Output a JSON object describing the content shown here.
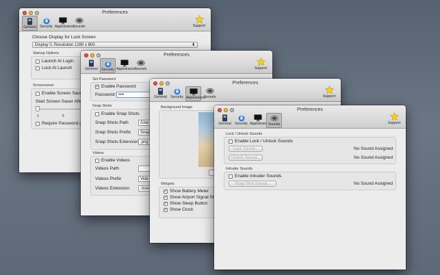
{
  "common": {
    "window_title": "Preferences",
    "tabs": [
      "General",
      "Security",
      "Appearance",
      "Sounds"
    ],
    "support_label": "Support"
  },
  "general": {
    "choose_display_label": "Choose Display for Lock Screen",
    "display_value": "Display 0, Resolution 1280 x 800",
    "startup_section": "Startup Options",
    "launch_at_login": "Launch At Login",
    "lock_at_launch": "Lock At Launch",
    "screensaver_section": "Screensaver",
    "enable_screen_saver": "Enable Screen Saver",
    "start_screen_saver_after": "Start Screen Saver After",
    "slider_ticks": [
      "1",
      "5"
    ],
    "require_password": "Require Password af"
  },
  "security": {
    "set_password_section": "Set Password",
    "enable_password": "Enable Password",
    "password_label": "Password:",
    "password_value": "••••",
    "snapshots_section": "Snap Shots",
    "enable_snap_shots": "Enable Snap Shots",
    "snap_shots_path_label": "Snap Shots Path",
    "snap_shots_path_value": "/Use",
    "snap_shots_prefix_label": "Snap Shots Prefix",
    "snap_shots_prefix_value": "Snap",
    "snap_shots_extension_label": "Snap Shots Extension",
    "snap_shots_extension_value": ".png",
    "videos_section": "Videos",
    "enable_videos": "Enable Videos",
    "videos_path_label": "Videos Path",
    "videos_prefix_label": "Videos Prefix",
    "videos_prefix_value": "Vide",
    "videos_extension_label": "Videos Extension",
    "videos_extension_value": ".mov"
  },
  "appearance": {
    "background_image_section": "Background Image",
    "widgets_section": "Widgets",
    "show_battery_meter": "Show Battery Meter",
    "show_airport_signal": "Show Airport Signal Str",
    "show_sleep_button": "Show Sleep Button",
    "show_clock": "Show Clock"
  },
  "sounds": {
    "lock_unlock_section": "Lock / Unlock Sounds",
    "enable_lock_unlock": "Enable Lock / Unlock Sounds",
    "lock_sound_button": "Lock Sound...",
    "unlock_sound_button": "Unlock Sound...",
    "lock_sound_status": "No Sound Assigned",
    "unlock_sound_status": "No Sound Assigned",
    "intruder_section": "Intruder Sounds",
    "enable_intruder": "Enable Intruder Sounds",
    "snap_shot_sound_button": "Snap Shot Sound...",
    "snap_shot_sound_status": "No Sound Assigned"
  }
}
